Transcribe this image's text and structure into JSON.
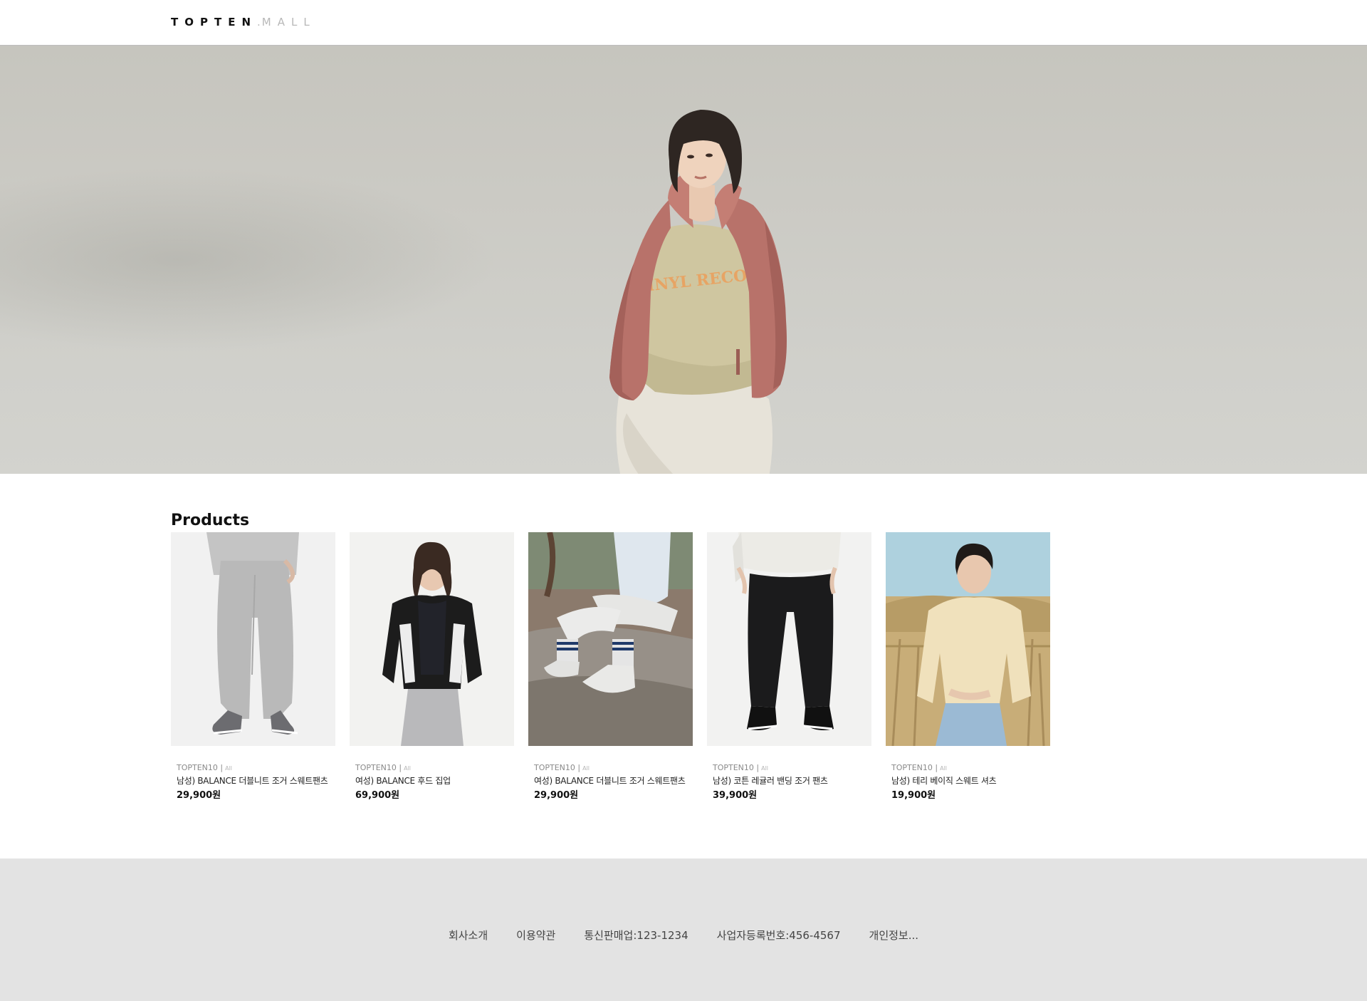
{
  "header": {
    "logo_primary": "TOPTEN",
    "logo_dot": ".",
    "logo_secondary": "MALL"
  },
  "hero": {
    "image_subject": "model-in-pink-fleece-jacket",
    "shirt_print": "VINYL RECORD"
  },
  "products_section": {
    "title": "Products",
    "items": [
      {
        "brand": "TOPTEN10 |",
        "category": "All",
        "name": "남성) BALANCE 더블니트 조거 스웨트팬츠",
        "price": "29,900원",
        "image_subject": "grey-jogger-pants"
      },
      {
        "brand": "TOPTEN10 |",
        "category": "All",
        "name": "여성) BALANCE 후드 집업",
        "price": "69,900원",
        "image_subject": "black-white-hood-zipup"
      },
      {
        "brand": "TOPTEN10 |",
        "category": "All",
        "name": "여성) BALANCE 더블니트 조거 스웨트팬츠",
        "price": "29,900원",
        "image_subject": "white-jogger-outdoor"
      },
      {
        "brand": "TOPTEN10 |",
        "category": "All",
        "name": "남성) 코튼 레귤러 밴딩 조거 팬츠",
        "price": "39,900원",
        "image_subject": "black-jogger-pants"
      },
      {
        "brand": "TOPTEN10 |",
        "category": "All",
        "name": "남성) 테리 베이직 스웨트 셔츠",
        "price": "19,900원",
        "image_subject": "beige-sweatshirt-man"
      }
    ]
  },
  "footer": {
    "links": [
      "회사소개",
      "이용약관",
      "통신판매업:123-1234",
      "사업자등록번호:456-4567",
      "개인정보..."
    ]
  },
  "colors": {
    "hero_bg": "#cbcac4",
    "footer_bg": "#e3e3e3",
    "jacket": "#b8726a",
    "text_muted": "#8a8a8a"
  }
}
